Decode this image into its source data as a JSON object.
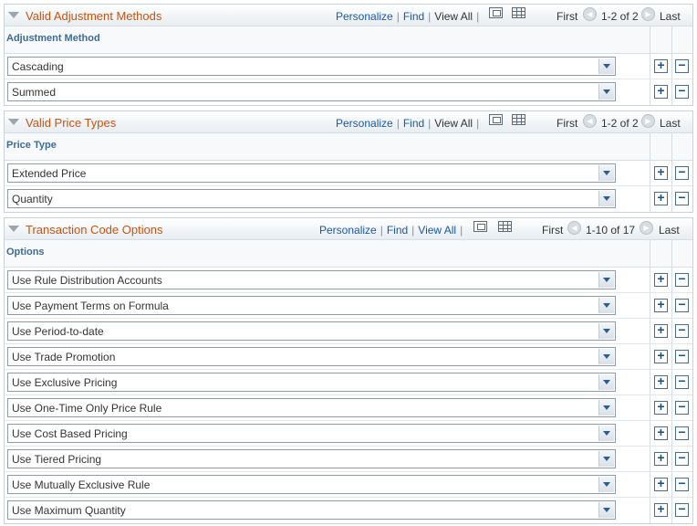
{
  "pager": {
    "first": "First",
    "last": "Last"
  },
  "toolbar": {
    "personalize": "Personalize",
    "find": "Find",
    "view_all": "View All",
    "sep": "|"
  },
  "sections": [
    {
      "title": "Valid Adjustment Methods",
      "column": "Adjustment Method",
      "range": "1-2 of 2",
      "rows": [
        "Cascading",
        "Summed"
      ]
    },
    {
      "title": "Valid Price Types",
      "column": "Price Type",
      "range": "1-2 of 2",
      "rows": [
        "Extended Price",
        "Quantity"
      ]
    },
    {
      "title": "Transaction Code Options",
      "column": "Options",
      "range": "1-10 of 17",
      "rows": [
        "Use Rule Distribution Accounts",
        "Use Payment Terms on Formula",
        "Use Period-to-date",
        "Use Trade Promotion",
        "Use Exclusive Pricing",
        "Use One-Time Only Price Rule",
        "Use Cost Based Pricing",
        "Use Tiered Pricing",
        "Use Mutually Exclusive Rule",
        "Use Maximum Quantity"
      ]
    }
  ],
  "icons": {
    "add": "+",
    "delete": "−",
    "prev": "◀",
    "next": "▶"
  }
}
